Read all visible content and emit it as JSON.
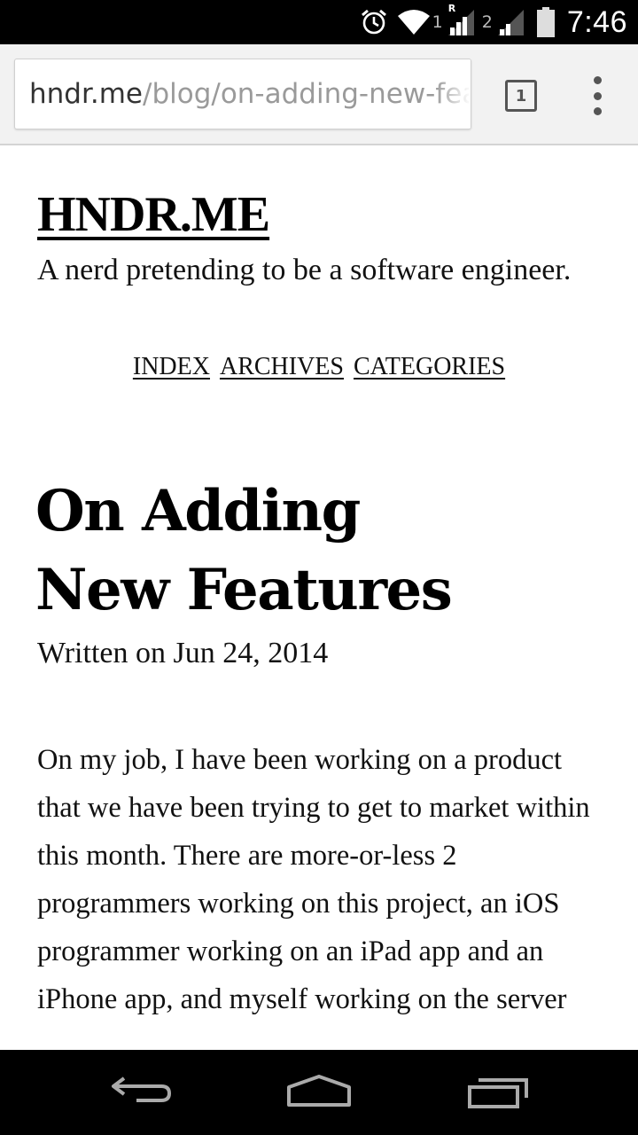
{
  "status_bar": {
    "sim1_label": "1",
    "roaming_label": "R",
    "sim2_label": "2",
    "time": "7:46",
    "icons": [
      "alarm-icon",
      "wifi-icon",
      "signal-icon",
      "signal-icon",
      "battery-icon"
    ]
  },
  "browser": {
    "url_host": "hndr.me",
    "url_path": "/blog/on-adding-new-features",
    "tab_count": "1"
  },
  "site": {
    "title": "HNDR.ME",
    "tagline": "A nerd pretending to be a software engineer.",
    "nav": [
      "INDEX",
      "ARCHIVES",
      "CATEGORIES"
    ]
  },
  "post": {
    "title_line1": "On Adding",
    "title_line2": "New Features",
    "date": "Written on Jun 24, 2014",
    "body": "On my job, I have been working on a product that we have been trying to get to market within this month. There are more-or-less 2 programmers working on this project, an iOS programmer working on an iPad app and an iPhone app, and myself working on the server"
  },
  "system_nav": {
    "icons": [
      "back-icon",
      "home-icon",
      "recents-icon"
    ]
  }
}
